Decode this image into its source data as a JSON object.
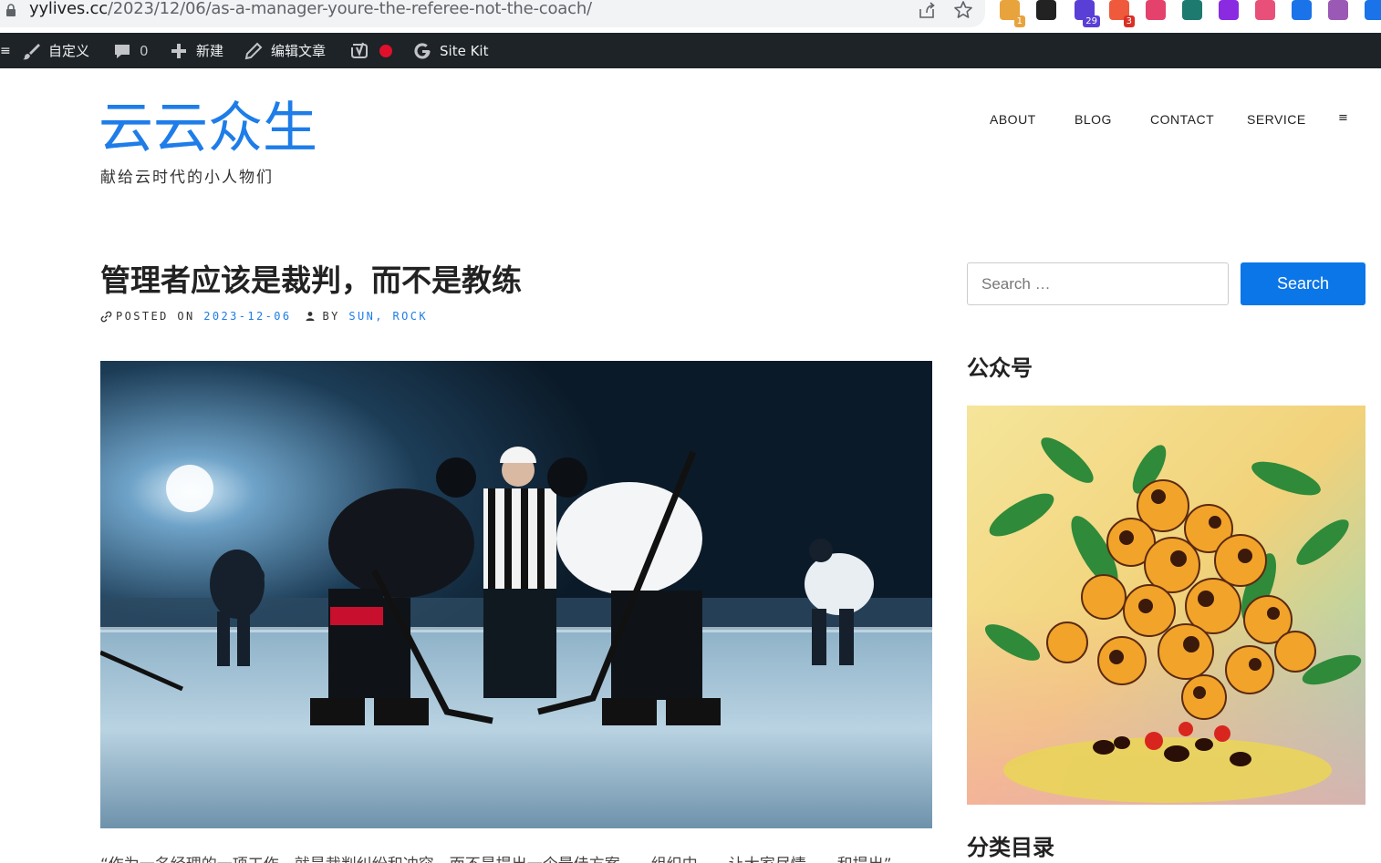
{
  "browser": {
    "url_host": "yylives.cc",
    "url_path": "/2023/12/06/as-a-manager-youre-the-referee-not-the-coach/",
    "extensions": [
      {
        "icon": "colorful-circle-extension-icon",
        "badge": "1",
        "color": "#e8a33c"
      },
      {
        "icon": "notion-extension-icon",
        "badge": "",
        "color": "#222222"
      },
      {
        "icon": "graduation-cap-extension-icon",
        "badge": "29",
        "color": "#5a3fd6"
      },
      {
        "icon": "bubbles-extension-icon",
        "badge": "3",
        "color": "#f05a3c"
      },
      {
        "icon": "translate-extension-icon",
        "badge": "",
        "color": "#e4426c"
      },
      {
        "icon": "tree-extension-icon",
        "badge": "",
        "color": "#1c7a6e"
      },
      {
        "icon": "purple-circle-extension-icon",
        "badge": "",
        "color": "#8a2be2"
      },
      {
        "icon": "baidu-paw-extension-icon",
        "badge": "",
        "color": "#e8507a"
      },
      {
        "icon": "pilcrow-extension-icon",
        "badge": "",
        "color": "#1a73e8"
      },
      {
        "icon": "openai-extension-icon",
        "badge": "",
        "color": "#9b59b6"
      },
      {
        "icon": "sync-extension-icon",
        "badge": "",
        "color": "#1a73e8"
      }
    ]
  },
  "admin_bar": {
    "customize": "自定义",
    "comments_count": "0",
    "new": "新建",
    "edit_post": "编辑文章",
    "site_kit": "Site Kit"
  },
  "site": {
    "title": "云云众生",
    "description": "献给云时代的小人物们",
    "accent": "#1e7de8"
  },
  "nav": {
    "items": [
      "ABOUT",
      "BLOG",
      "CONTACT",
      "SERVICE"
    ],
    "toggle": "≡"
  },
  "post": {
    "title": "管理者应该是裁判，而不是教练",
    "posted_on_label": "POSTED ON",
    "date": "2023-12-06",
    "by_label": "BY",
    "author": "SUN, ROCK",
    "body_peek": "“作为一名经理的一项工作，就是裁判纠纷和冲突，而不是提出一个最佳方案……组织中……让大家尽情……和提出”"
  },
  "sidebar": {
    "search_placeholder": "Search …",
    "search_button": "Search",
    "wechat_title": "公众号",
    "categories_title": "分类目录"
  }
}
